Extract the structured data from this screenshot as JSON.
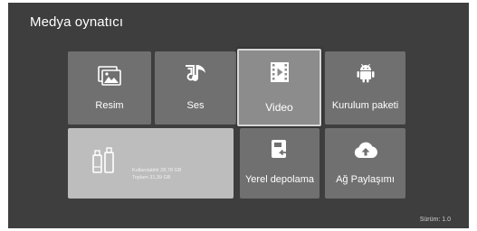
{
  "header": {
    "title": "Medya oynatıcı"
  },
  "tiles": {
    "picture": {
      "label": "Resim",
      "icon": "picture-icon"
    },
    "sound": {
      "label": "Ses",
      "icon": "music-note-icon"
    },
    "video": {
      "label": "Video",
      "icon": "film-play-icon"
    },
    "package": {
      "label": "Kurulum paketi",
      "icon": "android-icon"
    },
    "usb": {
      "icon": "usb-drive-icon",
      "available": "Kullanılabilir 28,78 GB",
      "total": "Toplam 31,39 GB"
    },
    "local": {
      "label": "Yerel depolama",
      "icon": "local-storage-icon"
    },
    "network": {
      "label": "Ağ Paylaşımı",
      "icon": "cloud-upload-icon"
    }
  },
  "footer": {
    "version": "Sürüm: 1.0"
  },
  "colors": {
    "background": "#3e3e3e",
    "tile": "#707070",
    "tile_focused": "#8c8c8c",
    "tile_light": "#bdbdbd"
  }
}
